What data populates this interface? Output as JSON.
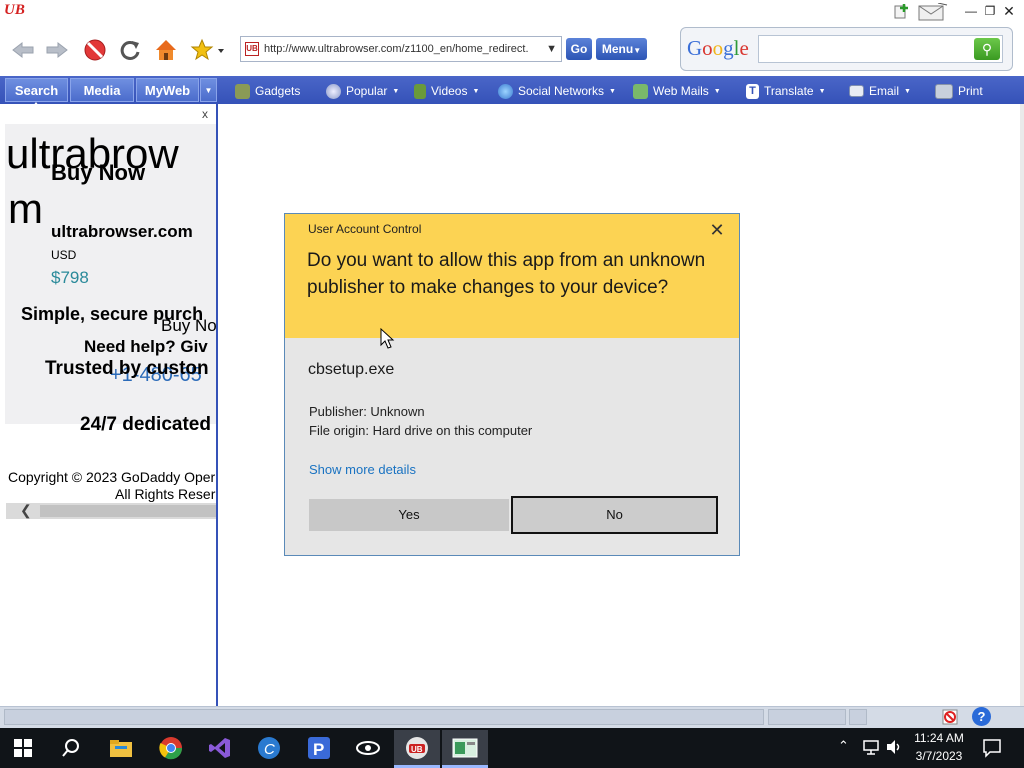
{
  "browser": {
    "logo": "UB",
    "address": "http://www.ultrabrowser.com/z1100_en/home_redirect.",
    "go_label": "Go",
    "menu_label": "Menu",
    "search_engine": "Google"
  },
  "tabs": [
    {
      "label": "Search"
    },
    {
      "label": "Media"
    },
    {
      "label": "MyWeb"
    }
  ],
  "links": [
    {
      "label": "Gadgets"
    },
    {
      "label": "Popular"
    },
    {
      "label": "Videos"
    },
    {
      "label": "Social Networks"
    },
    {
      "label": "Web Mails"
    },
    {
      "label": "Translate"
    },
    {
      "label": "Email"
    },
    {
      "label": "Print"
    }
  ],
  "sidebar": {
    "close": "x",
    "ghost_line1": "ultrabrow",
    "ghost_line2": "m",
    "buy_now": "Buy Now",
    "domain": "ultrabrowser.com",
    "currency": "USD",
    "price": "$798",
    "simple": "Simple, secure purch",
    "buy_now_small": "Buy No",
    "help": "Need help? Giv",
    "trusted": "Trusted by custon",
    "phone": "+1-480-65",
    "dedicated": "24/7 dedicated",
    "copyright": "Copyright © 2023 GoDaddy Oper",
    "rights": "All Rights Reser"
  },
  "dialog": {
    "title": "User Account Control",
    "question": "Do you want to allow this app from an unknown publisher to make changes to your device?",
    "app_name": "cbsetup.exe",
    "publisher": "Publisher: Unknown",
    "origin": "File origin: Hard drive on this computer",
    "details_link": "Show more details",
    "yes_label": "Yes",
    "no_label": "No"
  },
  "taskbar": {
    "time": "11:24 AM",
    "date": "3/7/2023"
  },
  "colors": {
    "dialog_header": "#fcd353",
    "link_bar": "#3552b8",
    "link_text": "#1a73c2"
  }
}
